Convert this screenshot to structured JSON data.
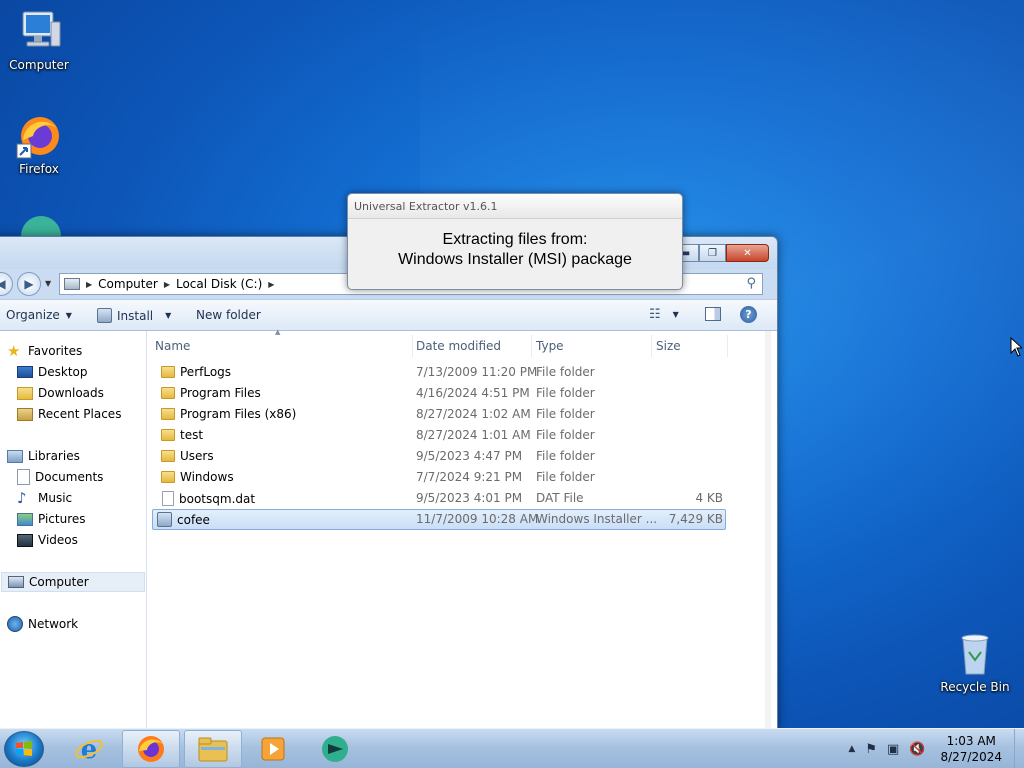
{
  "desktop": {
    "icons": [
      {
        "label": "Computer",
        "icon": "computer-icon"
      },
      {
        "label": "Firefox",
        "icon": "firefox-icon"
      },
      {
        "label": "Recycle Bin",
        "icon": "recycle-bin-icon"
      }
    ]
  },
  "popup": {
    "title": "Universal Extractor v1.6.1",
    "line1": "Extracting files from:",
    "line2": "Windows Installer (MSI) package"
  },
  "explorer": {
    "breadcrumb": [
      "Computer",
      "Local Disk (C:)"
    ],
    "toolbar": {
      "organize": "Organize",
      "install": "Install",
      "new_folder": "New folder"
    },
    "nav": {
      "favorites": "Favorites",
      "desktop": "Desktop",
      "downloads": "Downloads",
      "recent": "Recent Places",
      "libraries": "Libraries",
      "documents": "Documents",
      "music": "Music",
      "pictures": "Pictures",
      "videos": "Videos",
      "computer": "Computer",
      "network": "Network"
    },
    "columns": {
      "name": "Name",
      "date": "Date modified",
      "type": "Type",
      "size": "Size"
    },
    "files": [
      {
        "name": "PerfLogs",
        "date": "7/13/2009 11:20 PM",
        "type": "File folder",
        "size": "",
        "kind": "folder"
      },
      {
        "name": "Program Files",
        "date": "4/16/2024 4:51 PM",
        "type": "File folder",
        "size": "",
        "kind": "folder"
      },
      {
        "name": "Program Files (x86)",
        "date": "8/27/2024 1:02 AM",
        "type": "File folder",
        "size": "",
        "kind": "folder"
      },
      {
        "name": "test",
        "date": "8/27/2024 1:01 AM",
        "type": "File folder",
        "size": "",
        "kind": "folder"
      },
      {
        "name": "Users",
        "date": "9/5/2023 4:47 PM",
        "type": "File folder",
        "size": "",
        "kind": "folder"
      },
      {
        "name": "Windows",
        "date": "7/7/2024 9:21 PM",
        "type": "File folder",
        "size": "",
        "kind": "folder"
      },
      {
        "name": "bootsqm.dat",
        "date": "9/5/2023 4:01 PM",
        "type": "DAT File",
        "size": "4 KB",
        "kind": "file"
      },
      {
        "name": "cofee",
        "date": "11/7/2009 10:28 AM",
        "type": "Windows Installer ...",
        "size": "7,429 KB",
        "kind": "msi",
        "selected": true
      }
    ]
  },
  "taskbar": {
    "clock_time": "1:03 AM",
    "clock_date": "8/27/2024"
  }
}
